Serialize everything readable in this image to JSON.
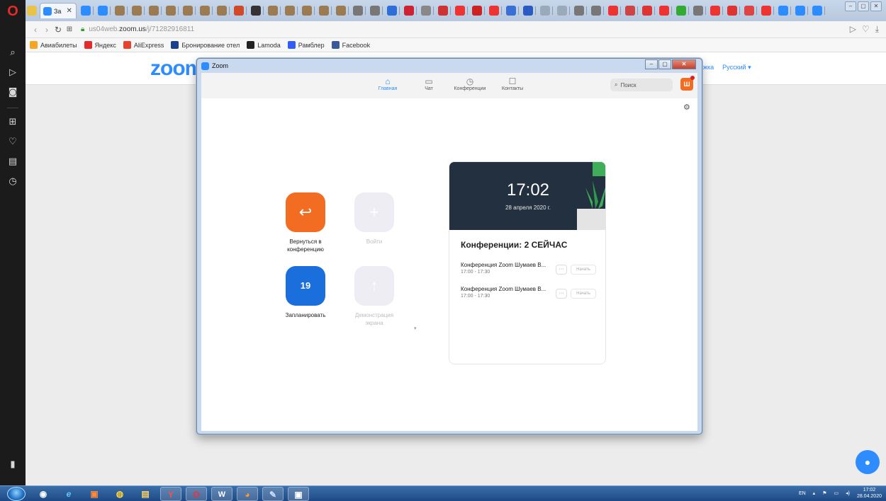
{
  "browser": {
    "active_tab_title": "За",
    "url_prefix": "us04web.",
    "url_domain": "zoom.us",
    "url_path": "/j/71282916811",
    "bookmarks": [
      {
        "label": "Авиабилеты",
        "icon": "plane-icon",
        "color": "#f5a623"
      },
      {
        "label": "Яндекс",
        "icon": "yandex-icon",
        "color": "#e32b2b"
      },
      {
        "label": "AliExpress",
        "icon": "aliexpress-icon",
        "color": "#e5432d"
      },
      {
        "label": "Бронирование отел",
        "icon": "booking-icon",
        "color": "#1a3f8f"
      },
      {
        "label": "Lamoda",
        "icon": "lamoda-icon",
        "color": "#222222"
      },
      {
        "label": "Рамблер",
        "icon": "rambler-icon",
        "color": "#315efb"
      },
      {
        "label": "Facebook",
        "icon": "facebook-icon",
        "color": "#3b5998"
      }
    ]
  },
  "page": {
    "logo": "zoom",
    "links": [
      "ержка",
      "Русский ▾"
    ]
  },
  "zoom": {
    "window_title": "Zoom",
    "nav": [
      {
        "label": "Главная",
        "icon": "home-icon",
        "active": true
      },
      {
        "label": "Чат",
        "icon": "chat-icon",
        "active": false
      },
      {
        "label": "Конференции",
        "icon": "clock-icon",
        "active": false
      },
      {
        "label": "Контакты",
        "icon": "contacts-icon",
        "active": false
      }
    ],
    "search_placeholder": "Поиск",
    "avatar_letter": "Ш",
    "actions": {
      "rejoin": "Вернуться в конференцию",
      "join": "Войти",
      "schedule": "Запланировать",
      "calendar_day": "19",
      "share_screen": "Демонстрация экрана"
    },
    "clock": {
      "time": "17:02",
      "date": "28 апреля 2020 г."
    },
    "meetings_title": "Конференции: 2 СЕЙЧАС",
    "meetings": [
      {
        "name": "Конференция Zoom Шумаев В...",
        "time": "17:00 - 17:30",
        "start_label": "Начать"
      },
      {
        "name": "Конференция Zoom Шумаев В...",
        "time": "17:00 - 17:30",
        "start_label": "Начать"
      }
    ],
    "colors": {
      "accent": "#2d8cff",
      "orange": "#f26d21",
      "clock_bg": "#23303f"
    }
  },
  "taskbar": {
    "lang": "EN",
    "time": "17:02",
    "date": "28.04.2020"
  }
}
